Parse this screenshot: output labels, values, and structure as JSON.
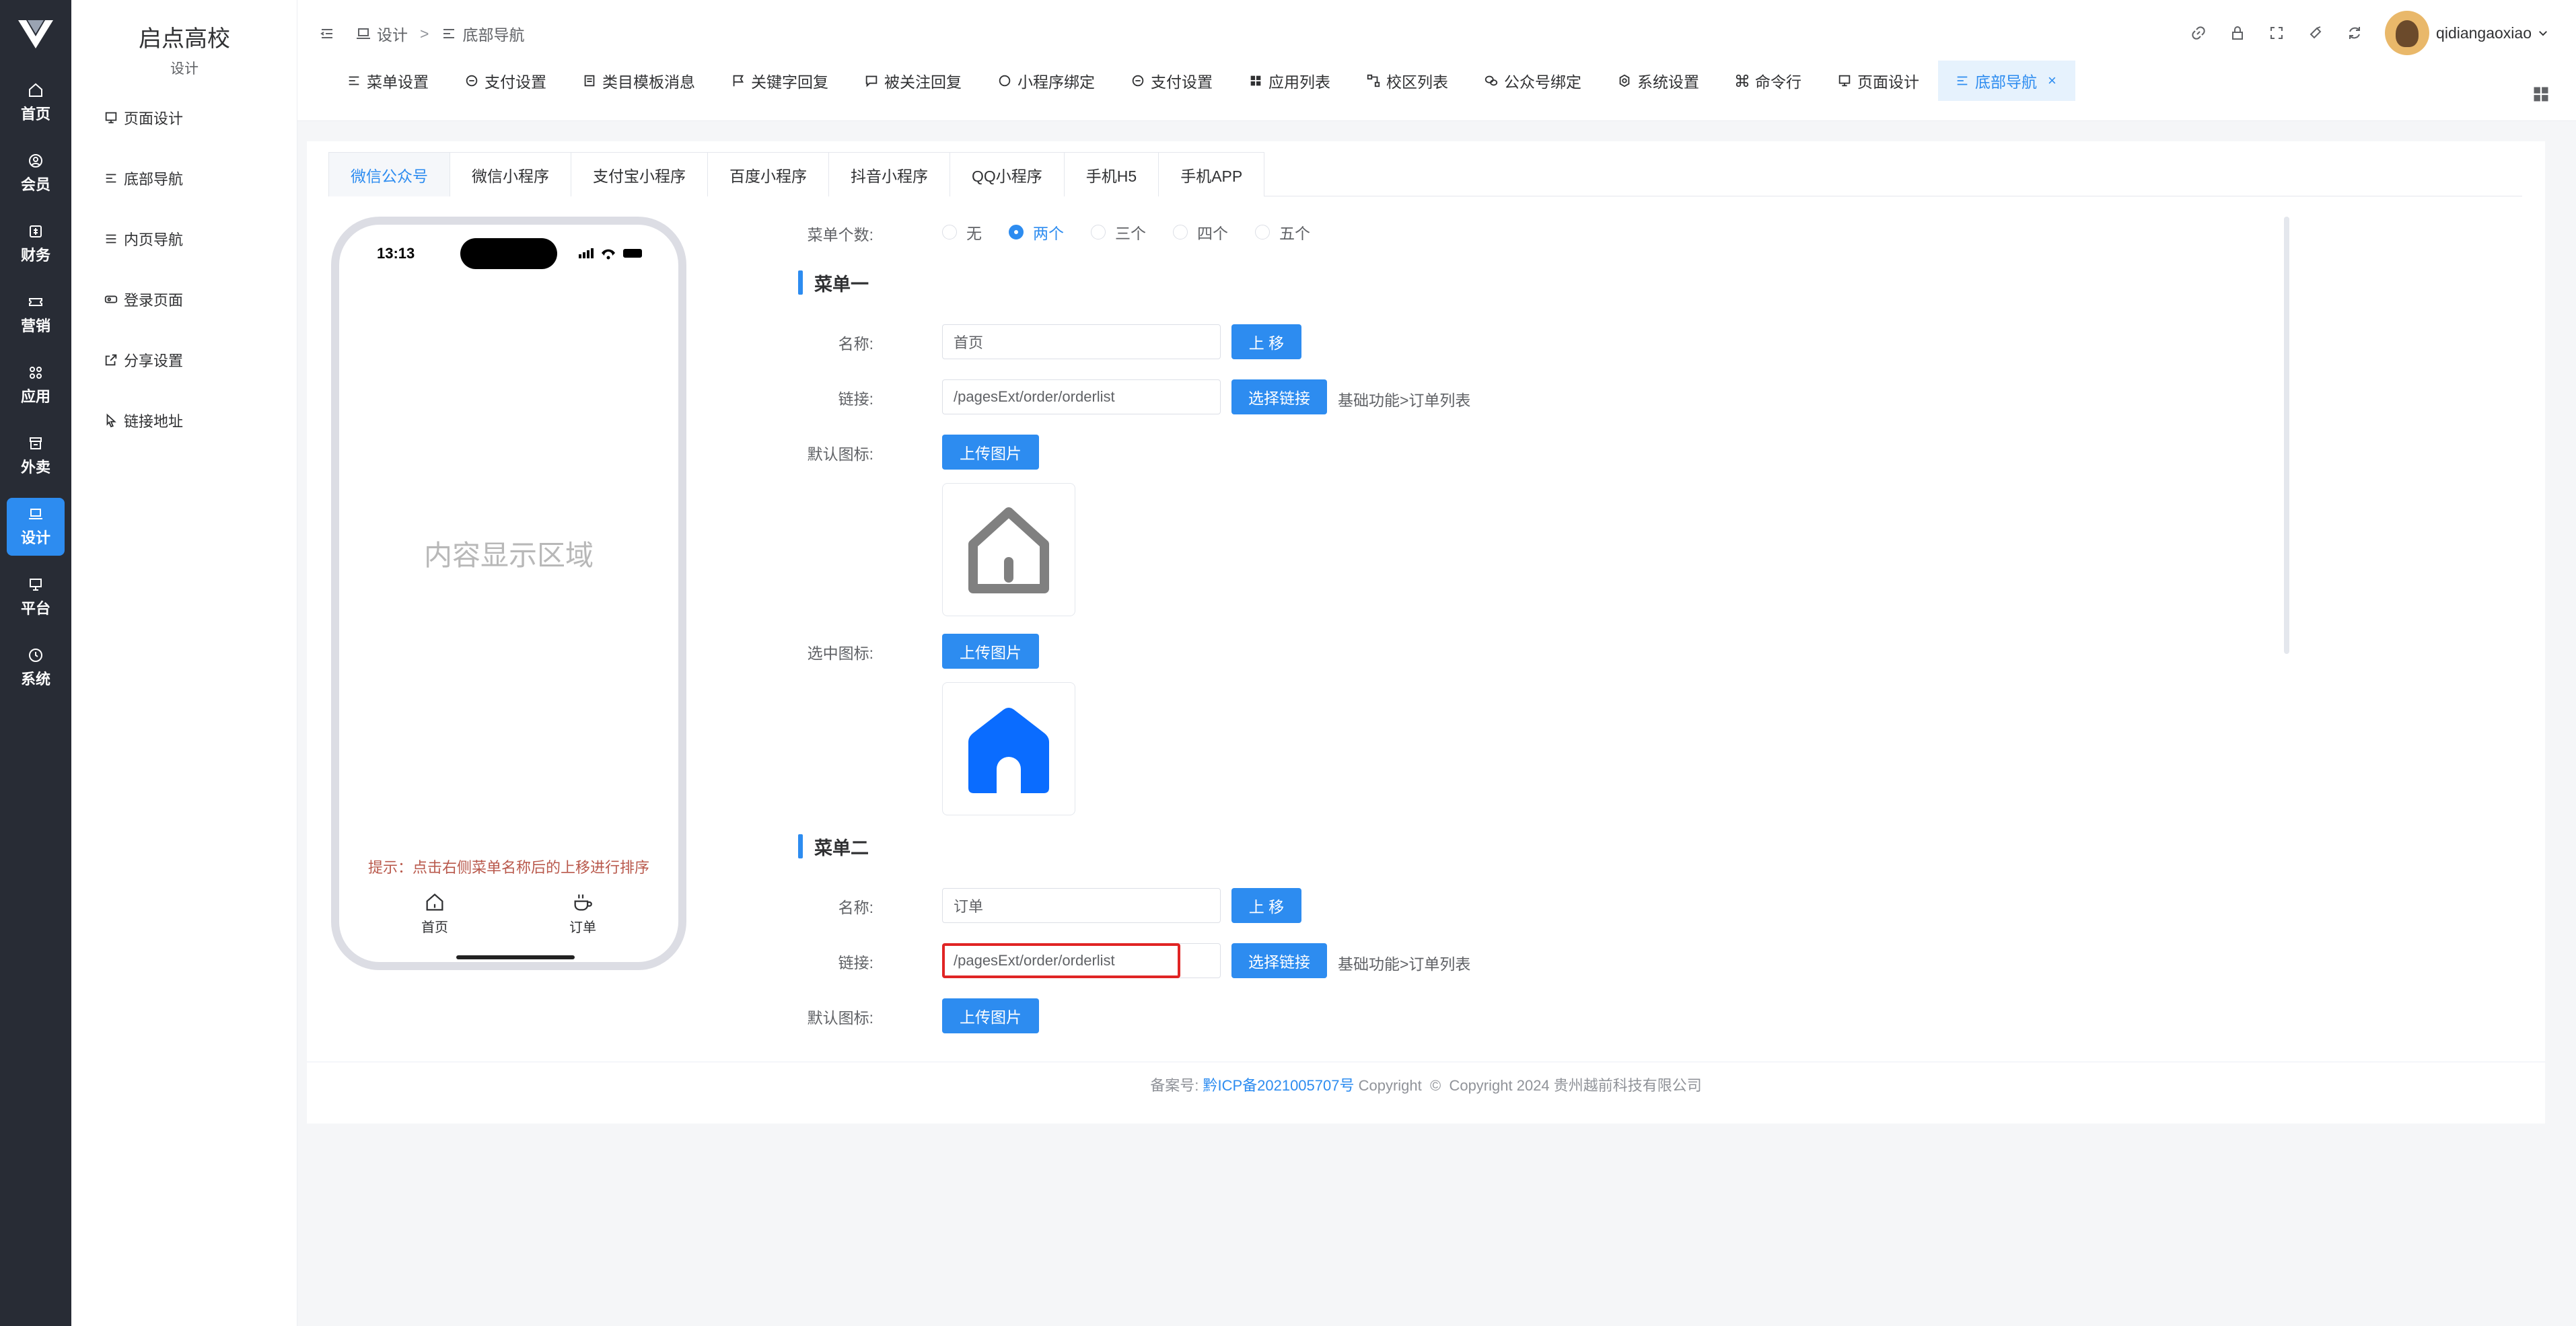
{
  "rail": {
    "items": [
      {
        "label": "首页",
        "icon": "home-icon"
      },
      {
        "label": "会员",
        "icon": "user-icon"
      },
      {
        "label": "财务",
        "icon": "money-icon"
      },
      {
        "label": "营销",
        "icon": "ticket-icon"
      },
      {
        "label": "应用",
        "icon": "apps-icon"
      },
      {
        "label": "外卖",
        "icon": "store-icon"
      },
      {
        "label": "设计",
        "icon": "laptop-icon",
        "active": true
      },
      {
        "label": "平台",
        "icon": "monitor-icon"
      },
      {
        "label": "系统",
        "icon": "clock-icon"
      }
    ]
  },
  "side2": {
    "title": "启点高校",
    "subtitle": "设计",
    "items": [
      {
        "label": "页面设计",
        "icon": "layout-icon"
      },
      {
        "label": "底部导航",
        "icon": "list-icon"
      },
      {
        "label": "内页导航",
        "icon": "menu-icon"
      },
      {
        "label": "登录页面",
        "icon": "login-icon"
      },
      {
        "label": "分享设置",
        "icon": "share-icon"
      },
      {
        "label": "链接地址",
        "icon": "pointer-icon"
      }
    ]
  },
  "header": {
    "breadcrumb": [
      "设计",
      "底部导航"
    ],
    "breadcrumb_sep": ">",
    "username": "qidiangaoxiao",
    "tabs": [
      {
        "label": "菜单设置",
        "icon": "menu-icon"
      },
      {
        "label": "支付设置",
        "icon": "chat-icon"
      },
      {
        "label": "类目模板消息",
        "icon": "doc-icon"
      },
      {
        "label": "关键字回复",
        "icon": "flag-icon"
      },
      {
        "label": "被关注回复",
        "icon": "message-icon"
      },
      {
        "label": "小程序绑定",
        "icon": "chat-icon"
      },
      {
        "label": "支付设置",
        "icon": "chat-icon"
      },
      {
        "label": "应用列表",
        "icon": "grid-icon"
      },
      {
        "label": "校区列表",
        "icon": "nodes-icon"
      },
      {
        "label": "公众号绑定",
        "icon": "wechat-icon"
      },
      {
        "label": "系统设置",
        "icon": "gear-icon"
      },
      {
        "label": "命令行",
        "icon": "command-icon"
      },
      {
        "label": "页面设计",
        "icon": "layout-icon"
      },
      {
        "label": "底部导航",
        "icon": "list-icon",
        "active": true,
        "close": "×"
      }
    ]
  },
  "platform_tabs": [
    "微信公众号",
    "微信小程序",
    "支付宝小程序",
    "百度小程序",
    "抖音小程序",
    "QQ小程序",
    "手机H5",
    "手机APP"
  ],
  "phone": {
    "time": "13:13",
    "content_area": "内容显示区域",
    "tip": "提示：点击右侧菜单名称后的上移进行排序",
    "nav": [
      {
        "label": "首页",
        "icon": "home-icon"
      },
      {
        "label": "订单",
        "icon": "cup-icon"
      }
    ]
  },
  "form": {
    "count_label": "菜单个数:",
    "count_options": [
      "无",
      "两个",
      "三个",
      "四个",
      "五个"
    ],
    "count_selected": "两个",
    "name_label": "名称:",
    "link_label": "链接:",
    "default_icon_label": "默认图标:",
    "selected_icon_label": "选中图标:",
    "upload_btn": "上传图片",
    "move_up_btn": "上 移",
    "select_link_btn": "选择链接",
    "menus": [
      {
        "title": "菜单一",
        "name": "首页",
        "link": "/pagesExt/order/orderlist",
        "path": "基础功能>订单列表"
      },
      {
        "title": "菜单二",
        "name": "订单",
        "link": "/pagesExt/order/orderlist",
        "path": "基础功能>订单列表"
      }
    ]
  },
  "footer": {
    "prefix": "备案号:",
    "icp": "黔ICP备2021005707号",
    "copyright_word": "Copyright",
    "copyright_text": "Copyright 2024 贵州越前科技有限公司"
  },
  "colors": {
    "accent": "#2d8cf0",
    "rail": "#282c35",
    "error": "#e02424"
  }
}
